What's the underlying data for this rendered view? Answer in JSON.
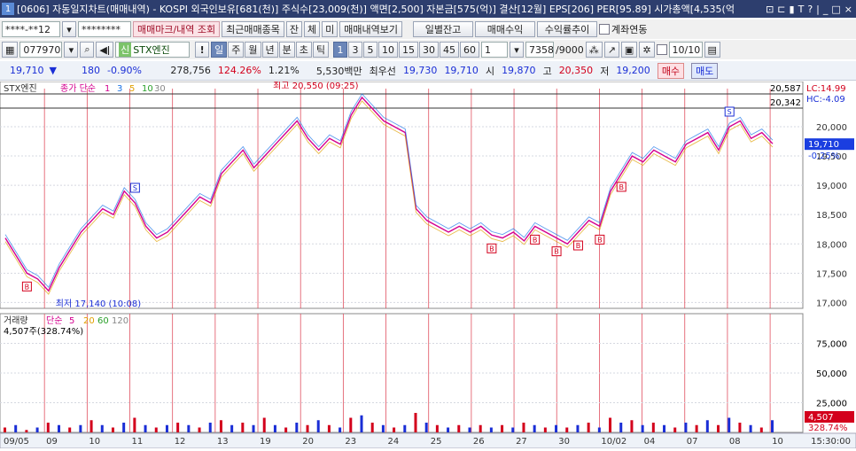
{
  "titlebar": {
    "window_no": "1",
    "text": "[0606] 자동일지차트(매매내역) - KOSPI 외국인보유[681(천)] 주식수[23,009(천)] 액면[2,500] 자본금[575(억)] 결산[12월] EPS[206] PER[95.89] 시가총액[4,535(억",
    "controls": [
      "⊡",
      "⊏",
      "▮",
      "T",
      "?",
      "|",
      "_",
      "□",
      "×"
    ]
  },
  "toolbar1": {
    "account": "****-**12",
    "password": "********",
    "btn_markup": "매매마크/내역 조회",
    "btn_recent": "최근매매종목",
    "btn_jan": "잔",
    "btn_che": "체",
    "btn_mi": "미",
    "btn_history": "매매내역보기",
    "btn_daily_balance": "일별잔고",
    "btn_trade_profit": "매매수익",
    "btn_profit_trend": "수익률추이",
    "chk_link_label": "계좌연동"
  },
  "toolbar2": {
    "code": "077970",
    "stock_name": "STX엔진",
    "periods": [
      "일",
      "주",
      "월",
      "년",
      "분",
      "초",
      "틱"
    ],
    "selected_period": "일",
    "minutes": [
      "1",
      "3",
      "5",
      "10",
      "15",
      "30",
      "45",
      "60"
    ],
    "selected_minute": "1",
    "interval": "1",
    "count": "7358",
    "count_total": "/9000",
    "date": "10/10"
  },
  "quote": {
    "price": "19,710",
    "arrow": "▼",
    "change": "180",
    "change_pct": "-0.90%",
    "volume": "278,756",
    "vol_ratio": "124.26%",
    "turnover": "1.21%",
    "amount": "5,530백만",
    "best_ask_label": "최우선",
    "best_ask": "19,730",
    "best_bid": "19,710",
    "open_label": "시",
    "open": "19,870",
    "high_label": "고",
    "high": "20,350",
    "low_label": "저",
    "low": "19,200",
    "buy": "매수",
    "sell": "매도"
  },
  "price_panel": {
    "legend_name": "STX엔진",
    "legend_type": "종가 단순",
    "ma_labels": [
      "1",
      "3",
      "5",
      "10",
      "30"
    ],
    "ma_colors": [
      "#d4008f",
      "#1a73e8",
      "#e0a000",
      "#2aa02a",
      "#888888"
    ],
    "max_value": "20,587",
    "close_value": "20,342",
    "lc": "LC:14.99",
    "hc": "HC:-4.09",
    "current_price": "19,710",
    "current_pct": "-0.25%",
    "high_annot": "최고 20,550 (09:25)",
    "low_annot": "최저 17,140 (10:08)",
    "y_ticks": [
      "20,000",
      "19,500",
      "19,000",
      "18,500",
      "18,000",
      "17,500",
      "17,000"
    ]
  },
  "volume_panel": {
    "legend_name": "거래량",
    "legend_type": "단순",
    "ma_labels": [
      "5",
      "20",
      "60",
      "120"
    ],
    "ma_colors": [
      "#d4008f",
      "#e0a000",
      "#2aa02a",
      "#888888"
    ],
    "summary": "4,507주(328.74%)",
    "y_ticks": [
      "75,000",
      "50,000",
      "25,000"
    ],
    "current_volume": "4,507",
    "current_pct": "328.74%"
  },
  "x_axis": {
    "labels": [
      "09/05",
      "09",
      "10",
      "11",
      "12",
      "13",
      "19",
      "20",
      "23",
      "24",
      "25",
      "26",
      "27",
      "30",
      "10/02",
      "04",
      "07",
      "08",
      "10"
    ],
    "time": "15:30:00"
  },
  "chart_data": {
    "type": "line",
    "title": "STX엔진",
    "series": [
      {
        "name": "STX엔진",
        "values": [
          18100,
          17800,
          17500,
          17400,
          17200,
          17600,
          17900,
          18200,
          18400,
          18600,
          18500,
          18900,
          18700,
          18300,
          18100,
          18200,
          18400,
          18600,
          18800,
          18700,
          19200,
          19400,
          19600,
          19300,
          19500,
          19700,
          19900,
          20100,
          19800,
          19600,
          19800,
          19700,
          20200,
          20500,
          20300,
          20100,
          20000,
          19900,
          18600,
          18400,
          18300,
          18200,
          18300,
          18200,
          18300,
          18150,
          18100,
          18200,
          18050,
          18300,
          18200,
          18100,
          18000,
          18200,
          18400,
          18300,
          18900,
          19200,
          19500,
          19400,
          19600,
          19500,
          19400,
          19700,
          19800,
          19900,
          19600,
          20000,
          20100,
          19800,
          19900,
          19710
        ]
      }
    ],
    "ylim": [
      16900,
      20650
    ],
    "buy_markers": [
      2,
      45,
      49,
      51,
      53,
      55,
      57
    ],
    "sell_markers": [
      12,
      67
    ],
    "volume": [
      2,
      3,
      1,
      2,
      4,
      3,
      2,
      3,
      5,
      3,
      2,
      4,
      6,
      3,
      2,
      3,
      4,
      3,
      2,
      4,
      5,
      3,
      4,
      3,
      6,
      3,
      2,
      4,
      3,
      5,
      3,
      2,
      6,
      7,
      4,
      3,
      2,
      3,
      8,
      4,
      3,
      2,
      3,
      2,
      3,
      2,
      3,
      2,
      4,
      3,
      2,
      3,
      2,
      3,
      4,
      2,
      6,
      4,
      5,
      3,
      4,
      3,
      2,
      4,
      3,
      5,
      3,
      6,
      4,
      3,
      2,
      5
    ]
  }
}
